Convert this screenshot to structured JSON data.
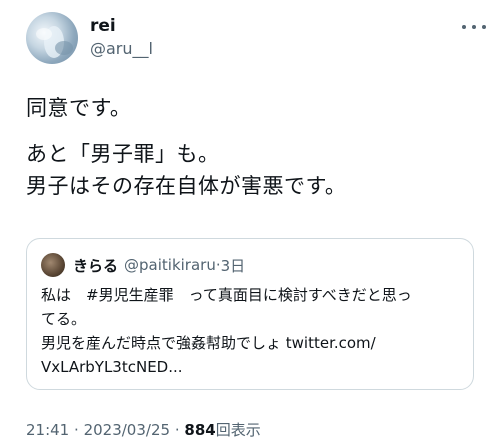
{
  "author": {
    "display_name": "rei",
    "handle": "@aru__l"
  },
  "tweet": {
    "line1": "同意です。",
    "line2": "あと「男子罪」も。",
    "line3": "男子はその存在自体が害悪です。"
  },
  "quoted_tweet": {
    "display_name": "きらる",
    "handle": "@paitikiraru",
    "separator": "·",
    "date": "3日",
    "line1": "私は　#男児生産罪　って真面目に検討すべきだと思っ",
    "line2": "てる。",
    "line3": "男児を産んだ時点で強姦幇助でしょ twitter.com/",
    "line4": "VxLArbYL3tcNED..."
  },
  "meta": {
    "time": "21:41",
    "separator": "·",
    "date": "2023/03/25",
    "separator2": "·",
    "views": "884",
    "views_label": "回表示"
  },
  "icons": {
    "more": "more-horizontal-icon"
  }
}
